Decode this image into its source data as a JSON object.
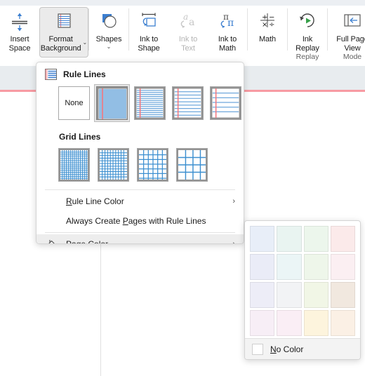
{
  "ribbon": {
    "buttons": [
      {
        "label": "Insert\nSpace",
        "icon": "insert-space-icon",
        "state": "normal",
        "chevron": false
      },
      {
        "label": "Format\nBackground",
        "icon": "format-background-icon",
        "state": "active",
        "chevron": true
      },
      {
        "label": "Shapes",
        "icon": "shapes-icon",
        "state": "normal",
        "chevron": true
      },
      {
        "label": "Ink to\nShape",
        "icon": "ink-to-shape-icon",
        "state": "normal",
        "chevron": false
      },
      {
        "label": "Ink to\nText",
        "icon": "ink-to-text-icon",
        "state": "disabled",
        "chevron": false
      },
      {
        "label": "Ink to\nMath",
        "icon": "ink-to-math-icon",
        "state": "normal",
        "chevron": false
      },
      {
        "label": "Math",
        "icon": "math-icon",
        "state": "normal",
        "chevron": false
      },
      {
        "label": "Ink\nReplay",
        "icon": "ink-replay-icon",
        "state": "normal",
        "chevron": false
      },
      {
        "label": "Full Page\nView",
        "icon": "full-page-view-icon",
        "state": "normal",
        "chevron": false
      }
    ],
    "group_captions": {
      "replay": "Replay",
      "mode": "Mode"
    }
  },
  "menu": {
    "rule_lines": {
      "icon": "rule-lines-icon",
      "title": "Rule Lines",
      "thumbnails": [
        {
          "name": "none",
          "label": "None",
          "selected": false
        },
        {
          "name": "narrow-ruled",
          "label": "",
          "selected": true
        },
        {
          "name": "college-ruled",
          "label": "",
          "selected": false
        },
        {
          "name": "standard-ruled",
          "label": "",
          "selected": false
        },
        {
          "name": "wide-ruled",
          "label": "",
          "selected": false
        }
      ]
    },
    "grid_lines": {
      "title": "Grid Lines",
      "thumbnails": [
        {
          "name": "small-grid",
          "selected": false
        },
        {
          "name": "medium-grid",
          "selected": false
        },
        {
          "name": "large-grid",
          "selected": false
        },
        {
          "name": "very-large-grid",
          "selected": false
        }
      ]
    },
    "items": [
      {
        "name": "rule-line-color",
        "label": "Rule Line Color",
        "accel": "R",
        "submenu": true,
        "icon": null,
        "highlight": false
      },
      {
        "name": "always-create-pages-with-rule-lines",
        "label": "Always Create Pages with Rule Lines",
        "accel": "P",
        "submenu": false,
        "icon": null,
        "highlight": false
      },
      {
        "name": "page-color",
        "label": "Page Color",
        "accel": "P",
        "submenu": true,
        "icon": "paint-bucket-icon",
        "highlight": true
      }
    ],
    "submenu_arrow": "›"
  },
  "palette": {
    "swatches": [
      "#e8eef8",
      "#e9f4f1",
      "#ecf6ec",
      "#fbeaea",
      "#eaecf7",
      "#ebf5f6",
      "#eef6ea",
      "#fbeff2",
      "#ededf7",
      "#f2f3f5",
      "#f1f6e6",
      "#f1e8df",
      "#f7eef6",
      "#faeef5",
      "#fdf4dd",
      "#fbf0e5"
    ],
    "no_color_label": "No Color",
    "no_color_accel": "N"
  },
  "colors": {
    "accent_blue": "#3c7fd0",
    "rule_red": "#f4767d",
    "page_rule": "#f79ba3",
    "page_band": "#e8ecef",
    "highlight_gray": "#ededed"
  }
}
